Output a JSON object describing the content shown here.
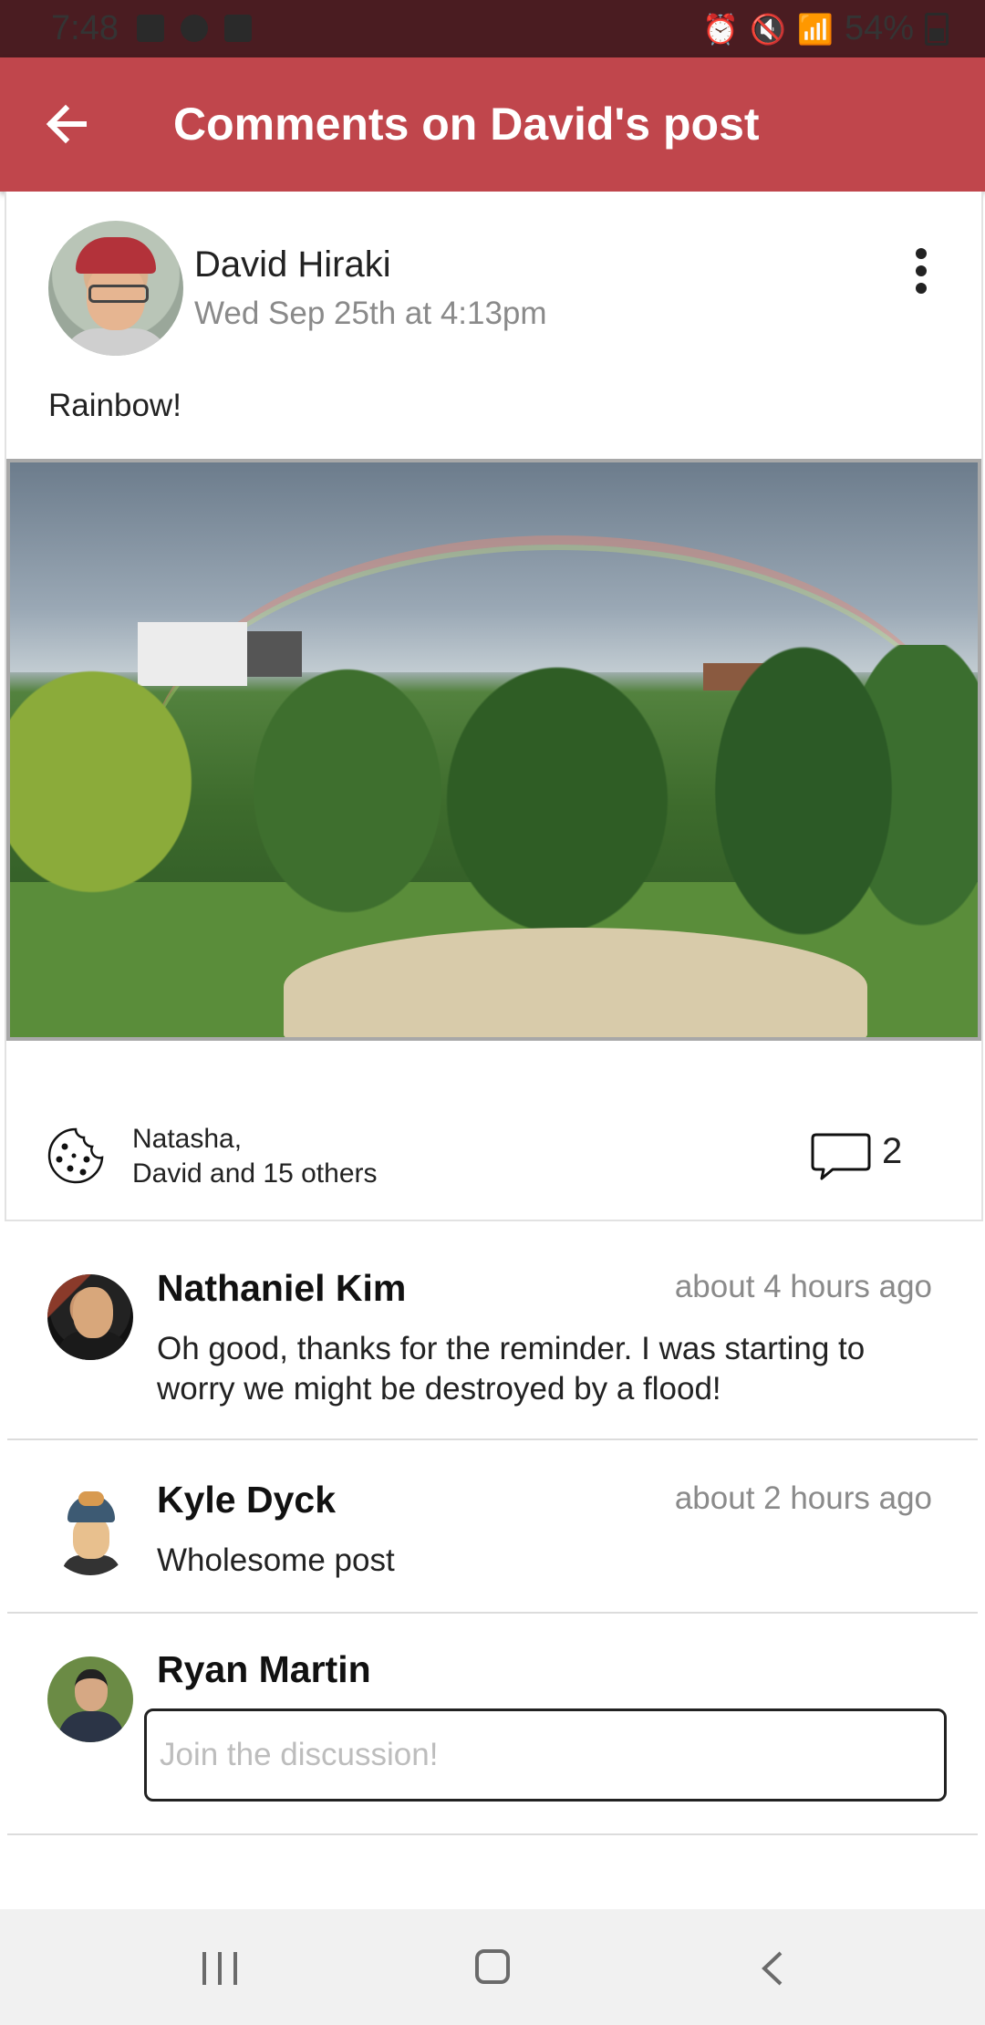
{
  "status_bar": {
    "time": "7:48",
    "battery": "54%"
  },
  "app_bar": {
    "title": "Comments on David's post",
    "back_icon": "arrow-left-icon"
  },
  "post": {
    "author": "David Hiraki",
    "timestamp": "Wed Sep 25th at 4:13pm",
    "text": "Rainbow!",
    "image_subject": "rainbow over trees",
    "reactions": {
      "line1": "Natasha,",
      "line2": "David and 15 others",
      "icon": "cookie-icon"
    },
    "comment_count": "2",
    "comment_icon": "speech-bubble-icon"
  },
  "comments": [
    {
      "name": "Nathaniel Kim",
      "time": "about 4 hours ago",
      "body": "Oh good, thanks for the reminder. I was starting to worry we might be destroyed by a flood!"
    },
    {
      "name": "Kyle Dyck",
      "time": "about 2 hours ago",
      "body": "Wholesome post"
    }
  ],
  "composer": {
    "name": "Ryan Martin",
    "value": "",
    "placeholder": "Join the discussion!"
  },
  "colors": {
    "status_bar": "#4a1c21",
    "app_bar": "#c0464c",
    "nav_bar": "#f1f1f1"
  }
}
